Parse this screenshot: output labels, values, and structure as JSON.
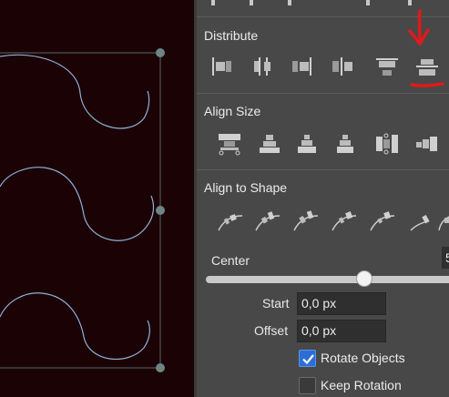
{
  "panel": {
    "distribute": {
      "title": "Distribute",
      "icons": [
        "distribute-left-edges-icon",
        "distribute-centers-horizontal-icon",
        "distribute-right-edges-icon",
        "distribute-horizontal-gaps-icon",
        "distribute-top-edges-icon",
        "distribute-centers-vertical-icon"
      ]
    },
    "align_size": {
      "title": "Align Size",
      "icons": [
        "align-size-width-icon",
        "align-size-height-icon",
        "align-size-step-icon",
        "align-size-step-alt-icon",
        "align-size-horizontal-icon",
        "align-size-horizontal-alt-icon"
      ]
    },
    "align_to_shape": {
      "title": "Align to Shape",
      "icons": [
        "align-shape-1-icon",
        "align-shape-2-icon",
        "align-shape-3-icon",
        "align-shape-4-icon",
        "align-shape-5-icon",
        "align-shape-6-icon",
        "align-shape-7-icon"
      ]
    },
    "center": {
      "label": "Center",
      "value": "5",
      "slider_fraction": 0.6
    },
    "start": {
      "label": "Start",
      "value": "0,0 px"
    },
    "offset": {
      "label": "Offset",
      "value": "0,0 px"
    },
    "rotate_objects": {
      "label": "Rotate Objects",
      "checked": true
    },
    "keep_rotation": {
      "label": "Keep Rotation",
      "checked": false
    }
  },
  "colors": {
    "canvas_bg": "#1b0204",
    "panel_bg": "#484848",
    "annotation": "#e0191b",
    "accent": "#2b6fd6"
  }
}
